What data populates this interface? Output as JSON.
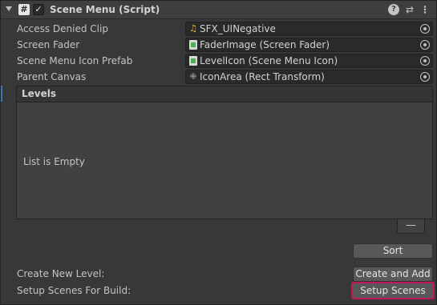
{
  "component": {
    "title": "Scene Menu (Script)",
    "script_glyph": "#",
    "enabled_glyph": "✓",
    "help_glyph": "?",
    "presets_glyph": "⇄",
    "menu_glyph": "⋮"
  },
  "properties": [
    {
      "label": "Access Denied Clip",
      "value": "SFX_UINegative",
      "icon": "audio-clip-icon"
    },
    {
      "label": "Screen Fader",
      "value": "FaderImage (Screen Fader)",
      "icon": "script-object-icon"
    },
    {
      "label": "Scene Menu Icon Prefab",
      "value": "LevelIcon (Scene Menu Icon)",
      "icon": "script-object-icon"
    },
    {
      "label": "Parent Canvas",
      "value": "IconArea (Rect Transform)",
      "icon": "rect-transform-icon"
    }
  ],
  "levels": {
    "title": "Levels",
    "empty_text": "List is Empty",
    "remove_label": "—"
  },
  "buttons": {
    "sort": "Sort",
    "create": "Create and Add",
    "setup": "Setup Scenes"
  },
  "footer": {
    "create_label": "Create New Level:",
    "setup_label": "Setup Scenes For Build:"
  },
  "colors": {
    "background": "#383838",
    "field": "#2a2a2a",
    "button": "#585858",
    "highlight": "#c2185b",
    "selection_accent": "#3a79bb"
  }
}
